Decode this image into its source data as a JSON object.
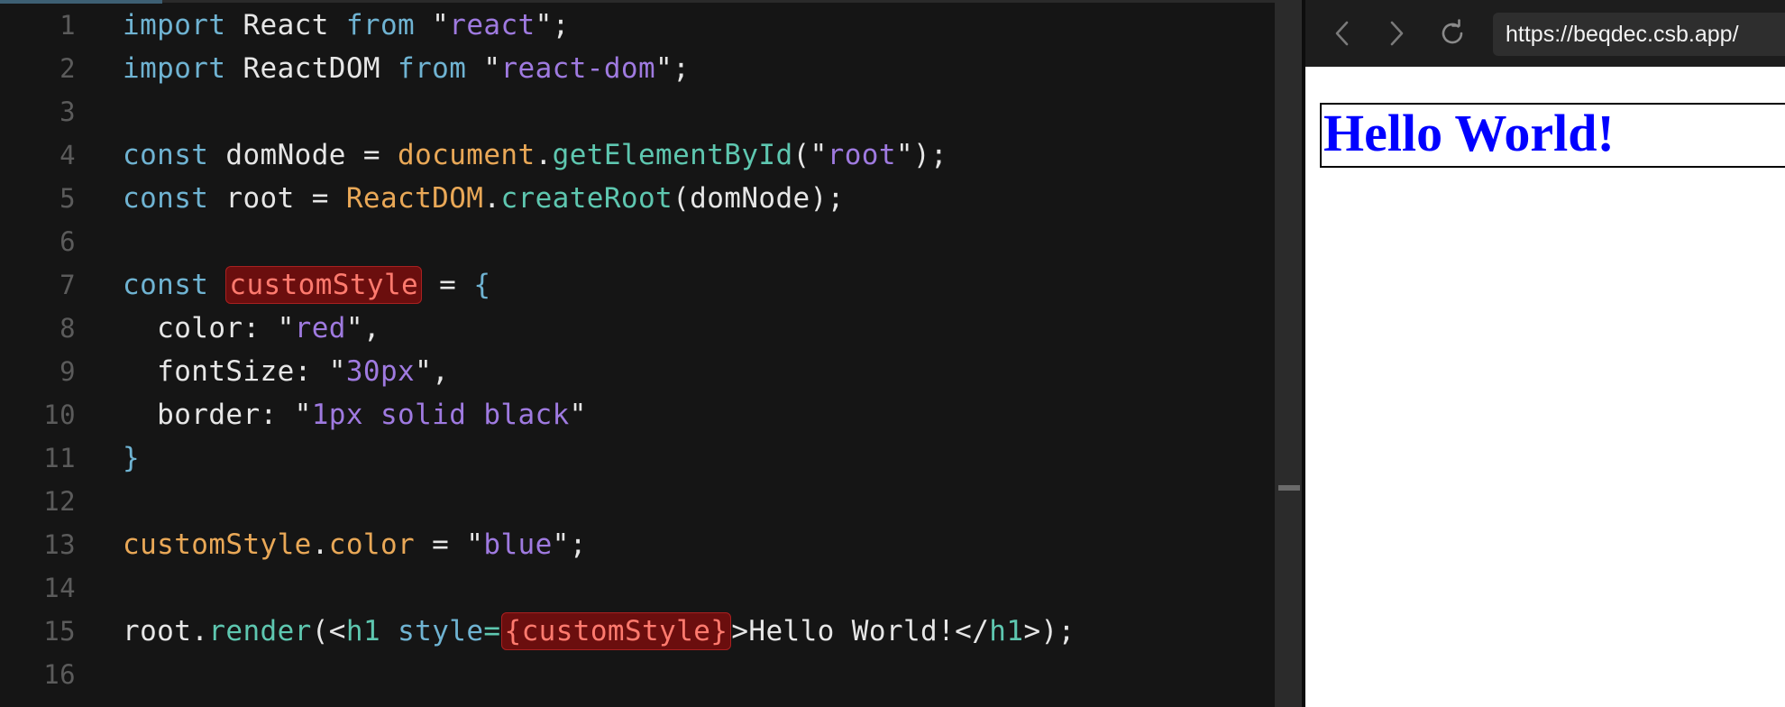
{
  "editor": {
    "line_numbers": [
      "1",
      "2",
      "3",
      "4",
      "5",
      "6",
      "7",
      "8",
      "9",
      "10",
      "11",
      "12",
      "13",
      "14",
      "15",
      "16"
    ],
    "lines": [
      [
        {
          "t": "import",
          "c": "kw"
        },
        {
          "t": " React ",
          "c": "plain"
        },
        {
          "t": "from",
          "c": "kw"
        },
        {
          "t": " \"",
          "c": "plain"
        },
        {
          "t": "react",
          "c": "str"
        },
        {
          "t": "\";",
          "c": "plain"
        }
      ],
      [
        {
          "t": "import",
          "c": "kw"
        },
        {
          "t": " ReactDOM ",
          "c": "plain"
        },
        {
          "t": "from",
          "c": "kw"
        },
        {
          "t": " \"",
          "c": "plain"
        },
        {
          "t": "react-dom",
          "c": "str"
        },
        {
          "t": "\";",
          "c": "plain"
        }
      ],
      [],
      [
        {
          "t": "const",
          "c": "kw"
        },
        {
          "t": " domNode = ",
          "c": "plain"
        },
        {
          "t": "document",
          "c": "obj"
        },
        {
          "t": ".",
          "c": "plain"
        },
        {
          "t": "getElementById",
          "c": "fn"
        },
        {
          "t": "(\"",
          "c": "plain"
        },
        {
          "t": "root",
          "c": "str"
        },
        {
          "t": "\");",
          "c": "plain"
        }
      ],
      [
        {
          "t": "const",
          "c": "kw"
        },
        {
          "t": " root = ",
          "c": "plain"
        },
        {
          "t": "ReactDOM",
          "c": "obj"
        },
        {
          "t": ".",
          "c": "plain"
        },
        {
          "t": "createRoot",
          "c": "fn"
        },
        {
          "t": "(domNode);",
          "c": "plain"
        }
      ],
      [],
      [
        {
          "t": "const",
          "c": "kw"
        },
        {
          "t": " ",
          "c": "plain"
        },
        {
          "t": "customStyle",
          "c": "hl"
        },
        {
          "t": " = ",
          "c": "plain"
        },
        {
          "t": "{",
          "c": "brace"
        }
      ],
      [
        {
          "t": "  color: \"",
          "c": "plain"
        },
        {
          "t": "red",
          "c": "str"
        },
        {
          "t": "\",",
          "c": "plain"
        }
      ],
      [
        {
          "t": "  fontSize: \"",
          "c": "plain"
        },
        {
          "t": "30px",
          "c": "str"
        },
        {
          "t": "\",",
          "c": "plain"
        }
      ],
      [
        {
          "t": "  border: \"",
          "c": "plain"
        },
        {
          "t": "1px solid black",
          "c": "str"
        },
        {
          "t": "\"",
          "c": "plain"
        }
      ],
      [
        {
          "t": "}",
          "c": "brace"
        }
      ],
      [],
      [
        {
          "t": "customStyle",
          "c": "obj"
        },
        {
          "t": ".",
          "c": "plain"
        },
        {
          "t": "color",
          "c": "obj"
        },
        {
          "t": " = \"",
          "c": "plain"
        },
        {
          "t": "blue",
          "c": "str"
        },
        {
          "t": "\";",
          "c": "plain"
        }
      ],
      [],
      [
        {
          "t": "root",
          "c": "plain"
        },
        {
          "t": ".",
          "c": "plain"
        },
        {
          "t": "render",
          "c": "fn"
        },
        {
          "t": "(<",
          "c": "plain"
        },
        {
          "t": "h1",
          "c": "tag"
        },
        {
          "t": " ",
          "c": "plain"
        },
        {
          "t": "style",
          "c": "attr"
        },
        {
          "t": "=",
          "c": "fn"
        },
        {
          "t": "{customStyle}",
          "c": "hl"
        },
        {
          "t": ">Hello World!</",
          "c": "plain"
        },
        {
          "t": "h1",
          "c": "tag"
        },
        {
          "t": ">);",
          "c": "plain"
        }
      ],
      []
    ]
  },
  "browser": {
    "back_icon": "chevron-left-icon",
    "forward_icon": "chevron-right-icon",
    "reload_icon": "reload-icon",
    "url": "https://beqdec.csb.app/",
    "heading_text": "Hello World!"
  },
  "colors": {
    "editor_bg": "#151515",
    "keyword": "#6fb3d2",
    "string": "#9f7ae0",
    "object": "#e9a857",
    "function": "#5ec7b0",
    "highlight_bg": "#6b0e0e",
    "highlight_fg": "#ff7a6e",
    "heading": "#0000ff"
  }
}
